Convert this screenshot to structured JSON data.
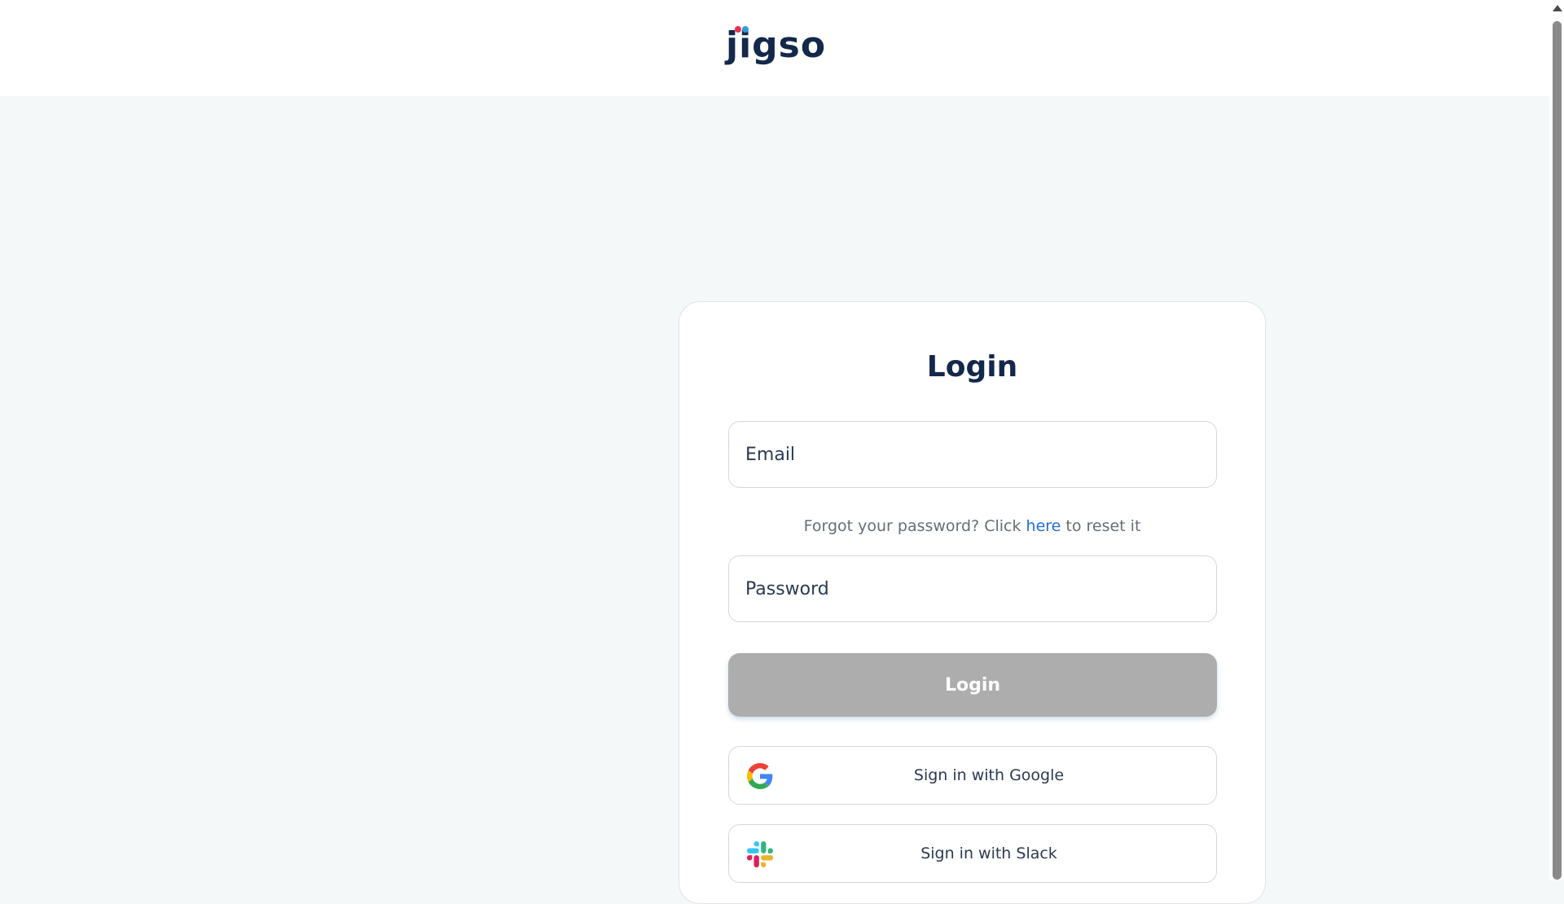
{
  "header": {
    "logo_text": "jigso",
    "logo_dot_colors": [
      "#e8344e",
      "#2f9ae0"
    ]
  },
  "login": {
    "title": "Login",
    "email_placeholder": "Email",
    "forgot_prefix": "Forgot your password? Click ",
    "forgot_link": "here",
    "forgot_suffix": " to reset it",
    "password_placeholder": "Password",
    "login_button": "Login",
    "google_button": "Sign in with Google",
    "slack_button": "Sign in with Slack"
  },
  "icons": {
    "google": "google-logo-icon",
    "slack": "slack-logo-icon"
  },
  "colors": {
    "brand_navy": "#13284a",
    "link_blue": "#1f6fd8",
    "login_button_disabled": "#adadad",
    "page_background": "#f5f8f9"
  }
}
